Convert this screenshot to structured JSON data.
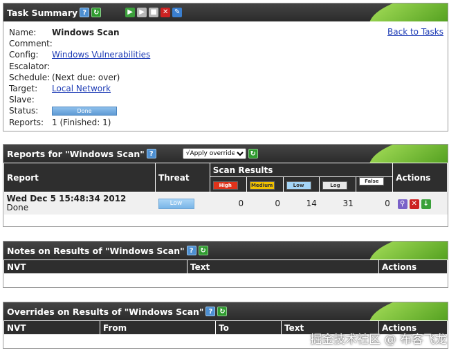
{
  "summary": {
    "title": "Task Summary",
    "back_link": "Back to Tasks",
    "fields": {
      "name_label": "Name:",
      "name_value": "Windows Scan",
      "comment_label": "Comment:",
      "config_label": "Config:",
      "config_value": "Windows Vulnerabilities",
      "escalator_label": "Escalator:",
      "schedule_label": "Schedule:",
      "schedule_value": "(Next due: over)",
      "target_label": "Target:",
      "target_value": "Local Network",
      "slave_label": "Slave:",
      "status_label": "Status:",
      "status_value": "Done",
      "status_progress": 1.0,
      "reports_label": "Reports:",
      "reports_value": "1 (Finished: 1)"
    }
  },
  "reports": {
    "title": "Reports for \"Windows Scan\"",
    "overrides_option": "√Apply overrides",
    "headers": {
      "report": "Report",
      "threat": "Threat",
      "scan_results": "Scan Results",
      "actions": "Actions"
    },
    "severity_labels": {
      "high": "High",
      "medium": "Medium",
      "low": "Low",
      "log": "Log",
      "false_pos": "False Pos"
    },
    "severity_colors": {
      "high": "#e0331b",
      "medium": "#f2c200",
      "low": "#a5d5f7",
      "log": "#e8e8e8",
      "false_pos": "#ffffff"
    },
    "row": {
      "date": "Wed Dec 5 15:48:34 2012",
      "status": "Done",
      "threat": "Low",
      "high": "0",
      "medium": "0",
      "low": "14",
      "log": "31",
      "false_pos": "0"
    },
    "action_icons": [
      "details-icon",
      "delete-icon",
      "download-icon"
    ]
  },
  "notes": {
    "title": "Notes on Results of \"Windows Scan\"",
    "headers": {
      "nvt": "NVT",
      "text": "Text",
      "actions": "Actions"
    }
  },
  "overrides": {
    "title": "Overrides on Results of \"Windows Scan\"",
    "headers": {
      "nvt": "NVT",
      "from": "From",
      "to": "To",
      "text": "Text",
      "actions": "Actions"
    }
  },
  "watermark": "掘金技术社区 @ 布客飞龙"
}
